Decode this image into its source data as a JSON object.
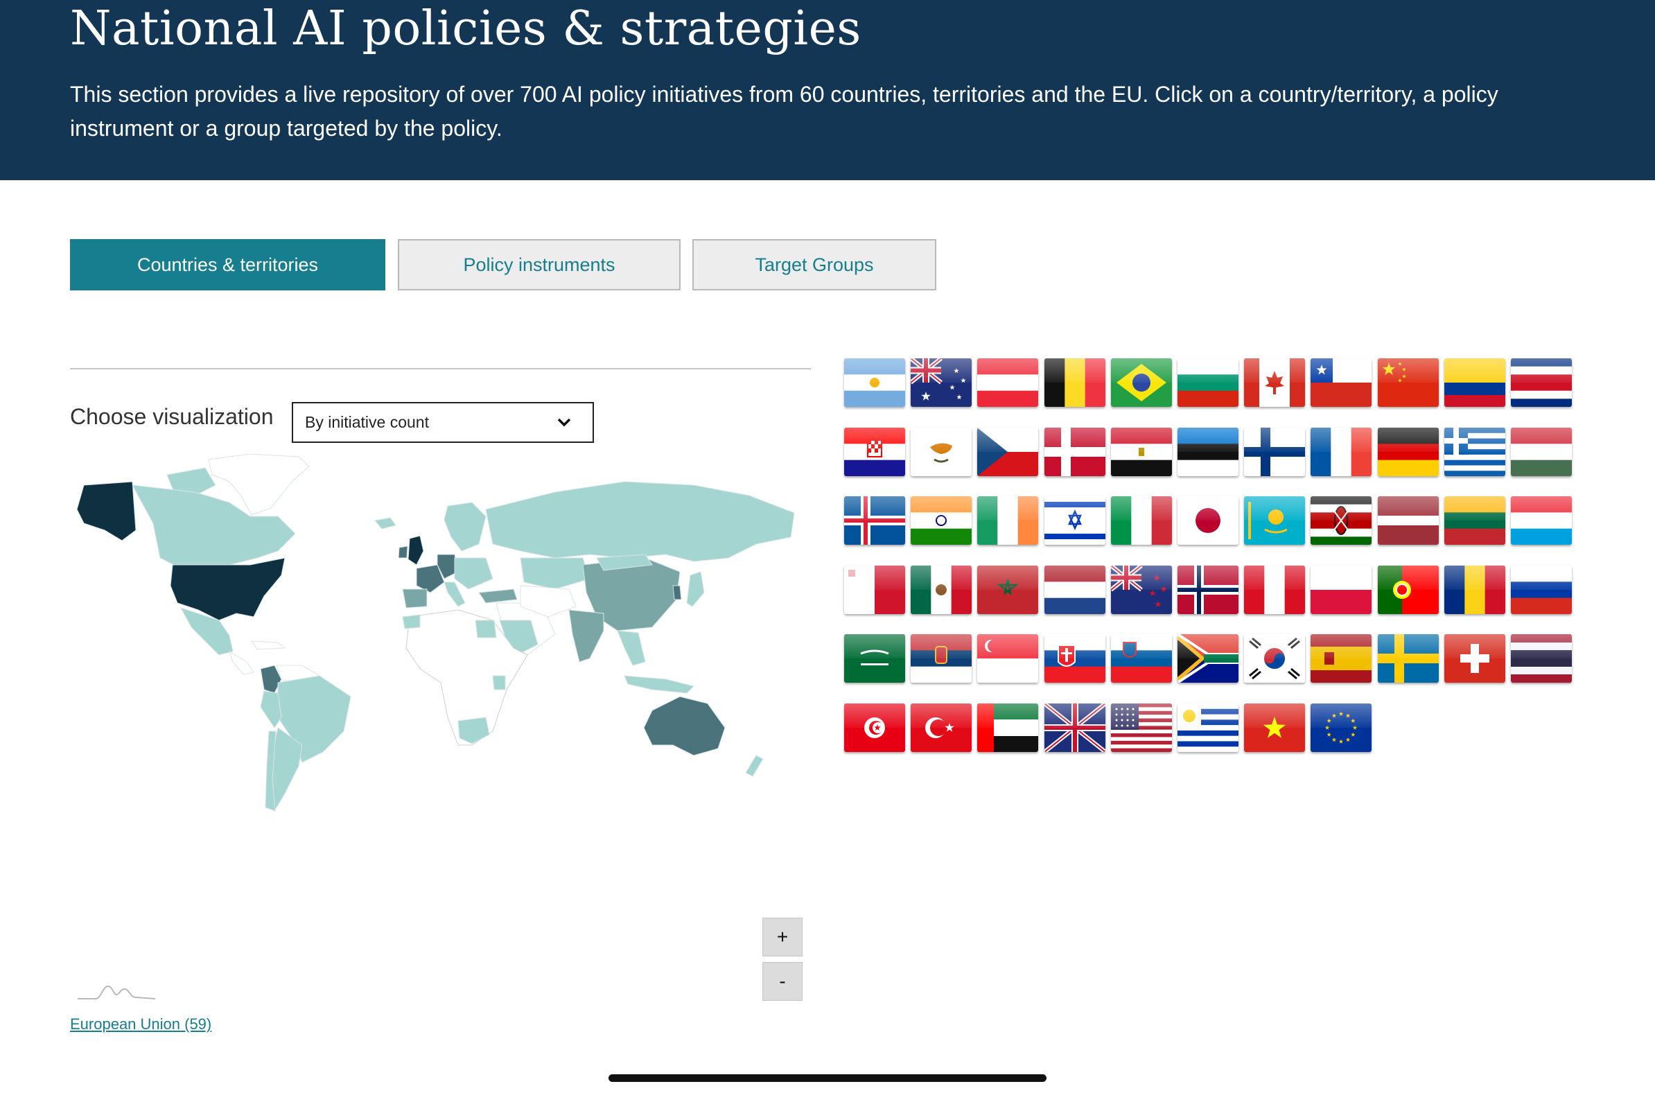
{
  "header": {
    "title": "National AI policies & strategies",
    "description": "This section provides a live repository of over 700 AI policy initiatives from 60 countries, territories and the EU. Click on a country/territory, a policy instrument or a group targeted by the policy."
  },
  "tabs": [
    {
      "label": "Countries & territories",
      "active": true
    },
    {
      "label": "Policy instruments",
      "active": false
    },
    {
      "label": "Target Groups",
      "active": false
    }
  ],
  "visualization": {
    "label": "Choose visualization",
    "selected": "By initiative count",
    "icon": "chevron-down-icon"
  },
  "map": {
    "zoom_in_label": "+",
    "zoom_out_label": "-",
    "colors": {
      "highest": "#0f3040",
      "high": "#4a737c",
      "medium": "#7aa7a6",
      "low": "#a4d5d1",
      "none": "#ffffff"
    }
  },
  "flags": [
    "argentina-flag",
    "australia-flag",
    "austria-flag",
    "belgium-flag",
    "brazil-flag",
    "bulgaria-flag",
    "canada-flag",
    "chile-flag",
    "china-flag",
    "colombia-flag",
    "costa-rica-flag",
    "croatia-flag",
    "cyprus-flag",
    "czech-republic-flag",
    "denmark-flag",
    "egypt-flag",
    "estonia-flag",
    "finland-flag",
    "france-flag",
    "germany-flag",
    "greece-flag",
    "hungary-flag",
    "iceland-flag",
    "india-flag",
    "ireland-flag",
    "israel-flag",
    "italy-flag",
    "japan-flag",
    "kazakhstan-flag",
    "kenya-flag",
    "latvia-flag",
    "lithuania-flag",
    "luxembourg-flag",
    "malta-flag",
    "mexico-flag",
    "morocco-flag",
    "netherlands-flag",
    "new-zealand-flag",
    "norway-flag",
    "peru-flag",
    "poland-flag",
    "portugal-flag",
    "romania-flag",
    "russia-flag",
    "saudi-arabia-flag",
    "serbia-flag",
    "singapore-flag",
    "slovakia-flag",
    "slovenia-flag",
    "south-africa-flag",
    "south-korea-flag",
    "spain-flag",
    "sweden-flag",
    "switzerland-flag",
    "thailand-flag",
    "tunisia-flag",
    "turkey-flag",
    "uae-flag",
    "united-kingdom-flag",
    "united-states-flag",
    "uruguay-flag",
    "vietnam-flag",
    "european-union-flag"
  ],
  "footer": {
    "eu_link": "European Union (59)"
  }
}
